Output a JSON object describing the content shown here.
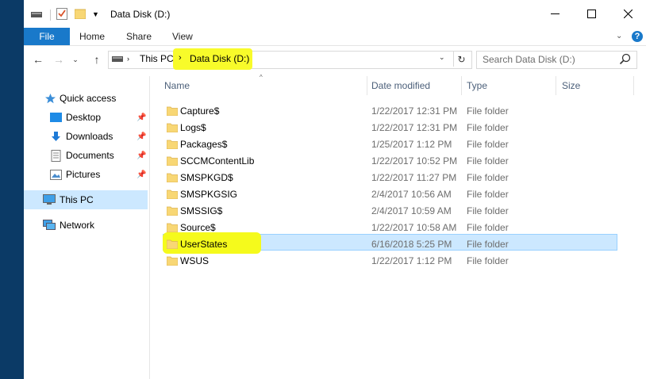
{
  "window": {
    "title": "Data Disk (D:)"
  },
  "ribbon": {
    "tabs": [
      "File",
      "Home",
      "Share",
      "View"
    ],
    "help_label": "?"
  },
  "address": {
    "crumbs": [
      "This PC",
      "Data Disk (D:)"
    ]
  },
  "search": {
    "placeholder": "Search Data Disk (D:)"
  },
  "nav": {
    "items": [
      {
        "label": "Quick access",
        "icon": "star-icon"
      },
      {
        "label": "Desktop",
        "icon": "desktop-icon",
        "pinned": true
      },
      {
        "label": "Downloads",
        "icon": "download-icon",
        "pinned": true
      },
      {
        "label": "Documents",
        "icon": "document-icon",
        "pinned": true
      },
      {
        "label": "Pictures",
        "icon": "pictures-icon",
        "pinned": true
      },
      {
        "label": "This PC",
        "icon": "computer-icon",
        "selected": true
      },
      {
        "label": "Network",
        "icon": "network-icon"
      }
    ]
  },
  "columns": {
    "name": "Name",
    "date": "Date modified",
    "type": "Type",
    "size": "Size"
  },
  "files": [
    {
      "name": "Capture$",
      "date": "1/22/2017 12:31 PM",
      "type": "File folder"
    },
    {
      "name": "Logs$",
      "date": "1/22/2017 12:31 PM",
      "type": "File folder"
    },
    {
      "name": "Packages$",
      "date": "1/25/2017 1:12 PM",
      "type": "File folder"
    },
    {
      "name": "SCCMContentLib",
      "date": "1/22/2017 10:52 PM",
      "type": "File folder"
    },
    {
      "name": "SMSPKGD$",
      "date": "1/22/2017 11:27 PM",
      "type": "File folder"
    },
    {
      "name": "SMSPKGSIG",
      "date": "2/4/2017 10:56 AM",
      "type": "File folder"
    },
    {
      "name": "SMSSIG$",
      "date": "2/4/2017 10:59 AM",
      "type": "File folder"
    },
    {
      "name": "Source$",
      "date": "1/22/2017 10:58 AM",
      "type": "File folder"
    },
    {
      "name": "UserStates",
      "date": "6/16/2018 5:25 PM",
      "type": "File folder",
      "selected": true
    },
    {
      "name": "WSUS",
      "date": "1/22/2017 1:12 PM",
      "type": "File folder"
    }
  ],
  "colors": {
    "accent": "#1979ca",
    "selection": "#cce8ff",
    "highlighter": "#f5fa1c",
    "folder": "#f8d775"
  }
}
